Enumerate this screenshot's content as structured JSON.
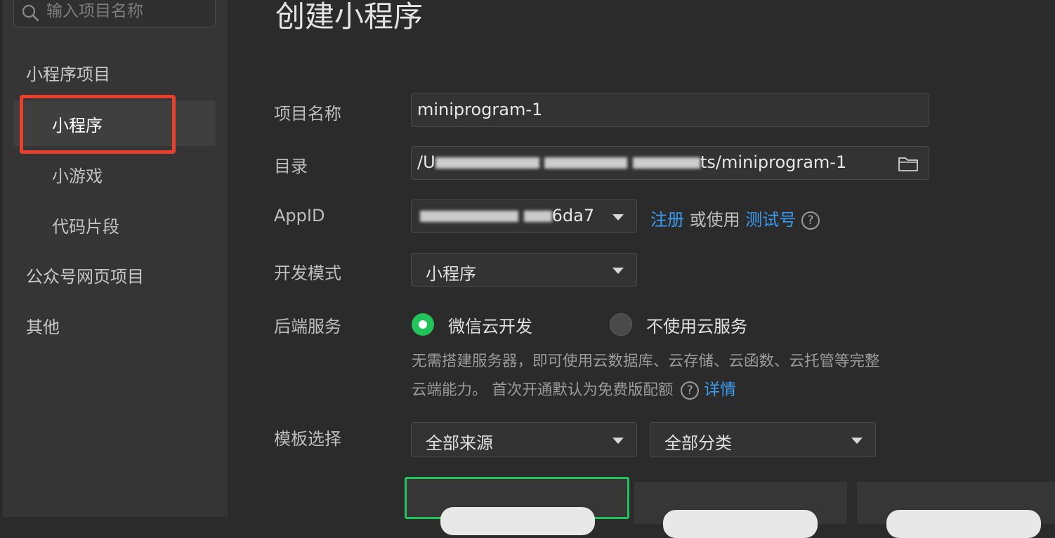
{
  "search": {
    "placeholder": "输入项目名称"
  },
  "sidebar": {
    "sections": [
      {
        "label": "小程序项目",
        "items": [
          "小程序",
          "小游戏",
          "代码片段"
        ]
      },
      {
        "label": "公众号网页项目"
      },
      {
        "label": "其他"
      }
    ],
    "active_item": "小程序"
  },
  "page": {
    "title": "创建小程序"
  },
  "form": {
    "project_name": {
      "label": "项目名称",
      "value": "miniprogram-1"
    },
    "directory": {
      "label": "目录",
      "value_prefix": "/U",
      "value_suffix": "ts/miniprogram-1"
    },
    "appid": {
      "label": "AppID",
      "value_visible_suffix": "6da7",
      "register_link": "注册",
      "or_use": "或使用",
      "test_link": "测试号",
      "help": "?"
    },
    "dev_mode": {
      "label": "开发模式",
      "value": "小程序"
    },
    "backend": {
      "label": "后端服务",
      "options": [
        {
          "label": "微信云开发",
          "selected": true
        },
        {
          "label": "不使用云服务",
          "selected": false
        }
      ],
      "desc_line1": "无需搭建服务器，即可使用云数据库、云存储、云函数、云托管等完整",
      "desc_line2": "云端能力。 首次开通默认为免费版配额",
      "help": "?",
      "details_link": "详情"
    },
    "template": {
      "label": "模板选择",
      "source_select": "全部来源",
      "category_select": "全部分类"
    }
  },
  "colors": {
    "accent_green": "#22c35a",
    "link_blue": "#3a9bf2",
    "highlight_red": "#e8402d"
  }
}
